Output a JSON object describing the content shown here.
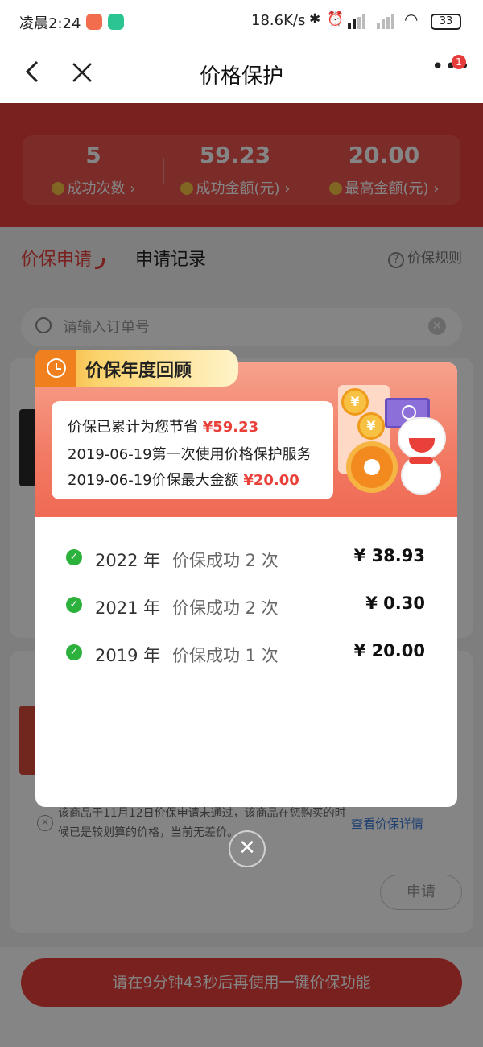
{
  "status_bar": {
    "time": "凌晨2:24",
    "network_speed": "18.6K/s",
    "battery": "33"
  },
  "navbar": {
    "title": "价格保护",
    "back_icon": "chevron-left-icon",
    "close_icon": "close-icon",
    "more_icon": "more-icon",
    "badge": "1"
  },
  "summary": {
    "stats": [
      {
        "value": "5",
        "label": "成功次数"
      },
      {
        "value": "59.23",
        "label": "成功金额(元)"
      },
      {
        "value": "20.00",
        "label": "最高金额(元)"
      }
    ]
  },
  "tabs": {
    "active": "价保申请",
    "other": "申请记录",
    "rules": "价保规则"
  },
  "search": {
    "placeholder": "请输入订单号"
  },
  "order": {
    "fail_note": "该商品于11月12日价保申请未通过，该商品在您购买的时候已是较划算的价格，当前无差价。",
    "detail_link": "查看价保详情",
    "apply_button": "申请"
  },
  "bottom": {
    "button": "请在9分钟43秒后再使用一键价保功能"
  },
  "modal": {
    "title": "价保年度回顾",
    "saved_prefix": "价保已累计为您节省",
    "saved_amount": "¥59.23",
    "first_use": "2019-06-19第一次使用价格保护服务",
    "max_prefix": "2019-06-19价保最大金额",
    "max_amount": "¥20.00",
    "rows": [
      {
        "year": "2022 年",
        "text": "价保成功 2 次",
        "amount": "¥ 38.93"
      },
      {
        "year": "2021 年",
        "text": "价保成功 2 次",
        "amount": "¥ 0.30"
      },
      {
        "year": "2019 年",
        "text": "价保成功 1 次",
        "amount": "¥ 20.00"
      }
    ]
  },
  "colors": {
    "brand_red": "#e9403a",
    "success_green": "#2bb13c",
    "tag_orange": "#f07f1d"
  }
}
